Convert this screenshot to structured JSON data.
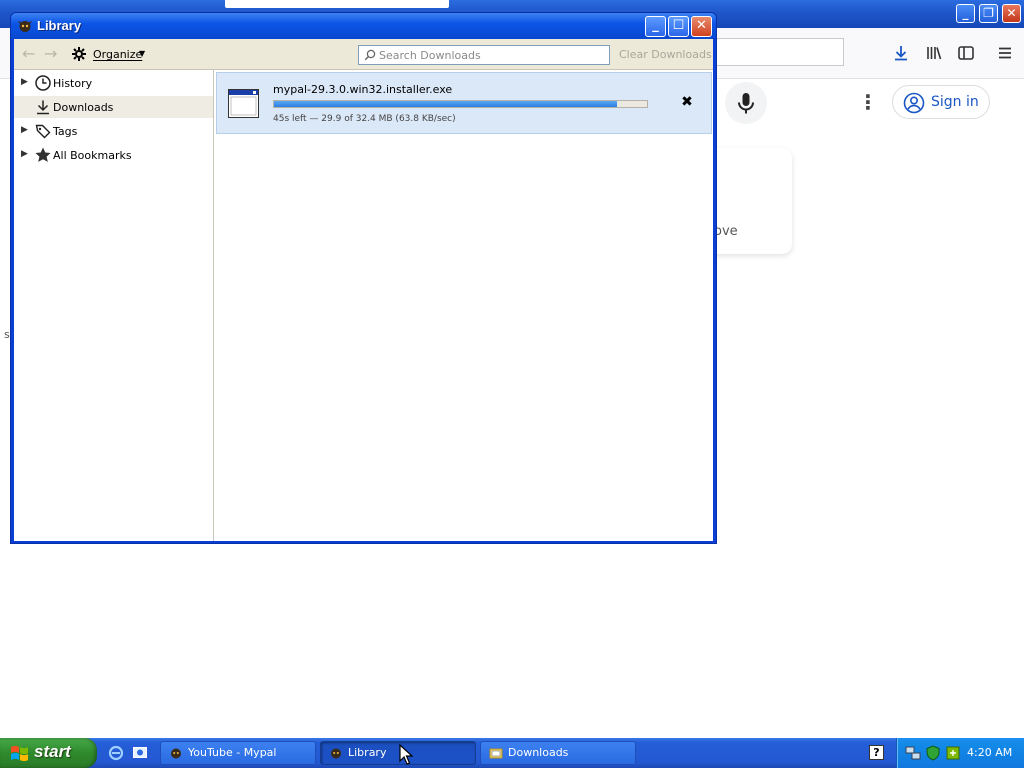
{
  "library_window": {
    "title": "Library",
    "toolbar": {
      "organize_label": "Organize",
      "search_placeholder": "Search Downloads",
      "clear_downloads_label": "Clear Downloads"
    },
    "sidebar": {
      "items": [
        {
          "label": "History",
          "icon": "clock-icon",
          "expandable": true
        },
        {
          "label": "Downloads",
          "icon": "download-icon",
          "expandable": false,
          "selected": true
        },
        {
          "label": "Tags",
          "icon": "tag-icon",
          "expandable": true
        },
        {
          "label": "All Bookmarks",
          "icon": "star-icon",
          "expandable": true
        }
      ]
    },
    "downloads": [
      {
        "filename": "mypal-29.3.0.win32.installer.exe",
        "status": "45s left — 29.9 of 32.4 MB (63.8 KB/sec)",
        "progress_percent": 92
      }
    ]
  },
  "browser": {
    "sign_in_label": "Sign in",
    "partial_card_text": "ove",
    "stray_text": "s"
  },
  "taskbar": {
    "start_label": "start",
    "tasks": [
      {
        "label": "YouTube - Mypal",
        "active": false
      },
      {
        "label": "Library",
        "active": true
      },
      {
        "label": "Downloads",
        "active": false
      }
    ],
    "clock": "4:20 AM"
  },
  "colors": {
    "xp_blue": "#0a3fd6",
    "selection_bg": "#dbe8f8",
    "progress": "#2c7ee0",
    "start_green": "#2f8a2d",
    "signin_blue": "#1a56c4"
  }
}
